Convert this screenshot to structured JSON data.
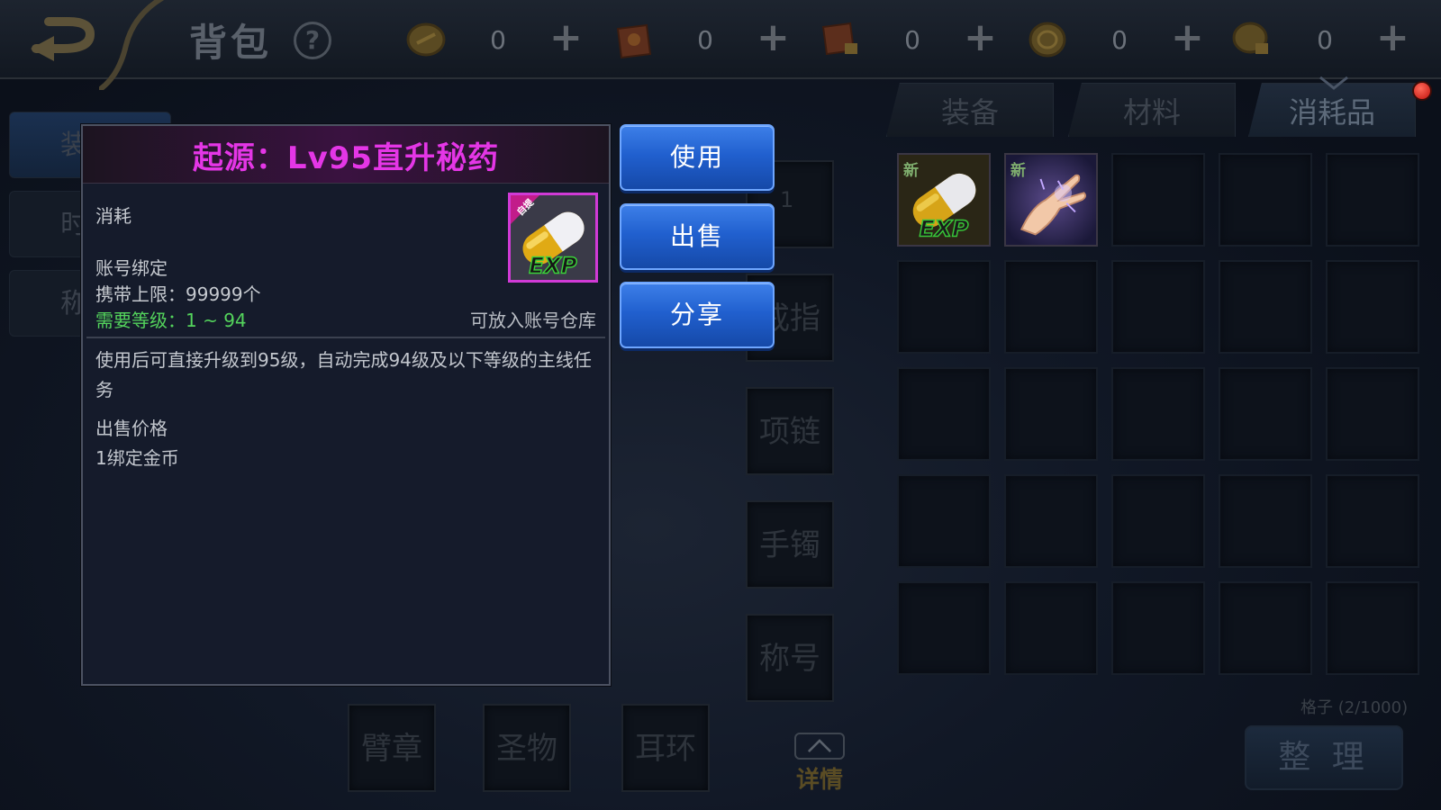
{
  "header": {
    "title": "背包",
    "help_icon": "?",
    "currencies": [
      {
        "icon": "gold-coin-icon",
        "amount": "0",
        "plus": "+"
      },
      {
        "icon": "gift-box-icon",
        "amount": "0",
        "plus": "+"
      },
      {
        "icon": "locked-box-icon",
        "amount": "0",
        "plus": "+"
      },
      {
        "icon": "silver-coin-icon",
        "amount": "0",
        "plus": "+"
      },
      {
        "icon": "locked-coin-icon",
        "amount": "0",
        "plus": "+"
      }
    ]
  },
  "tabs": [
    {
      "label": "装备"
    },
    {
      "label": "材料"
    },
    {
      "label": "消耗品",
      "active": true
    }
  ],
  "side_tabs": [
    "装",
    "时",
    "称"
  ],
  "equipment_slots": {
    "ring": "戒指",
    "necklace": "项链",
    "bracelet": "手镯",
    "title_slot": "称号",
    "armband": "臂章",
    "relic": "圣物",
    "earring": "耳环",
    "slot1_count": "1"
  },
  "detail": {
    "label": "详情"
  },
  "inventory": {
    "items": [
      {
        "badge": "新",
        "icon": "exp-capsule-icon",
        "icon_text": "EXP"
      },
      {
        "badge": "新",
        "icon": "magic-hand-icon"
      }
    ],
    "capacity": "格子 (2/1000)",
    "sort_label": "整 理"
  },
  "tooltip": {
    "title": "起源：Lv95直升秘药",
    "type": "消耗",
    "bind": "账号绑定",
    "carry_limit": "携带上限：99999个",
    "level_req": "需要等级：1 ~ 94",
    "storage_note": "可放入账号仓库",
    "description": "使用后可直接升级到95级，自动完成94级及以下等级的主线任务",
    "price_label": "出售价格",
    "price_value": "1绑定金币",
    "icon_badge": "自提",
    "icon_text": "EXP",
    "accent": "#e436e6",
    "req_color": "#54d45c"
  },
  "actions": {
    "use": "使用",
    "sell": "出售",
    "share": "分享"
  }
}
